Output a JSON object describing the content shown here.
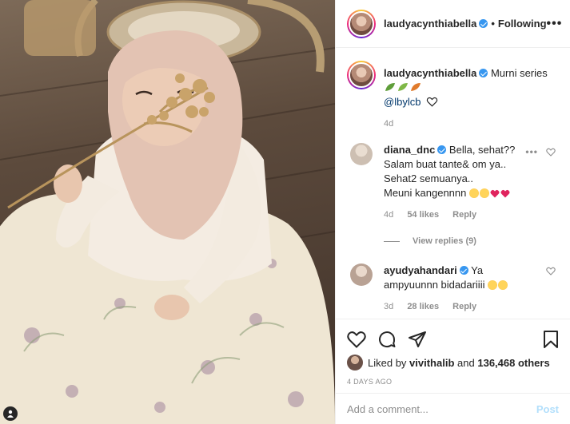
{
  "header": {
    "username": "laudyacynthiabella",
    "separator": "•",
    "follow_status": "Following",
    "more_label": "•••"
  },
  "caption": {
    "username": "laudyacynthiabella",
    "text": "Murni series",
    "mention": "@lbylcb",
    "age": "4d"
  },
  "comments": [
    {
      "username": "diana_dnc",
      "verified": true,
      "lines": [
        "Bella, sehat??",
        "Salam buat tante& om ya..",
        "Sehat2 semuanya..",
        "Meuni kangennnn"
      ],
      "age": "4d",
      "likes": "54 likes",
      "reply_label": "Reply",
      "more_label": "•••"
    },
    {
      "username": "ayudyahandari",
      "verified": true,
      "lines": [
        "Ya",
        "ampyuunnn bidadariiii"
      ],
      "age": "3d",
      "likes": "28 likes",
      "reply_label": "Reply"
    }
  ],
  "view_replies": "View replies (9)",
  "likes": {
    "prefix": "Liked by",
    "user": "vivithalib",
    "joiner": "and",
    "others": "136,468 others"
  },
  "timestamp": "4 DAYS AGO",
  "add_comment": {
    "placeholder": "Add a comment...",
    "post_label": "Post"
  },
  "colors": {
    "verified": "#3897f0",
    "muted": "#8e8e8e",
    "post_disabled": "#b2dffc",
    "heart_emoji": "#e0245e"
  }
}
